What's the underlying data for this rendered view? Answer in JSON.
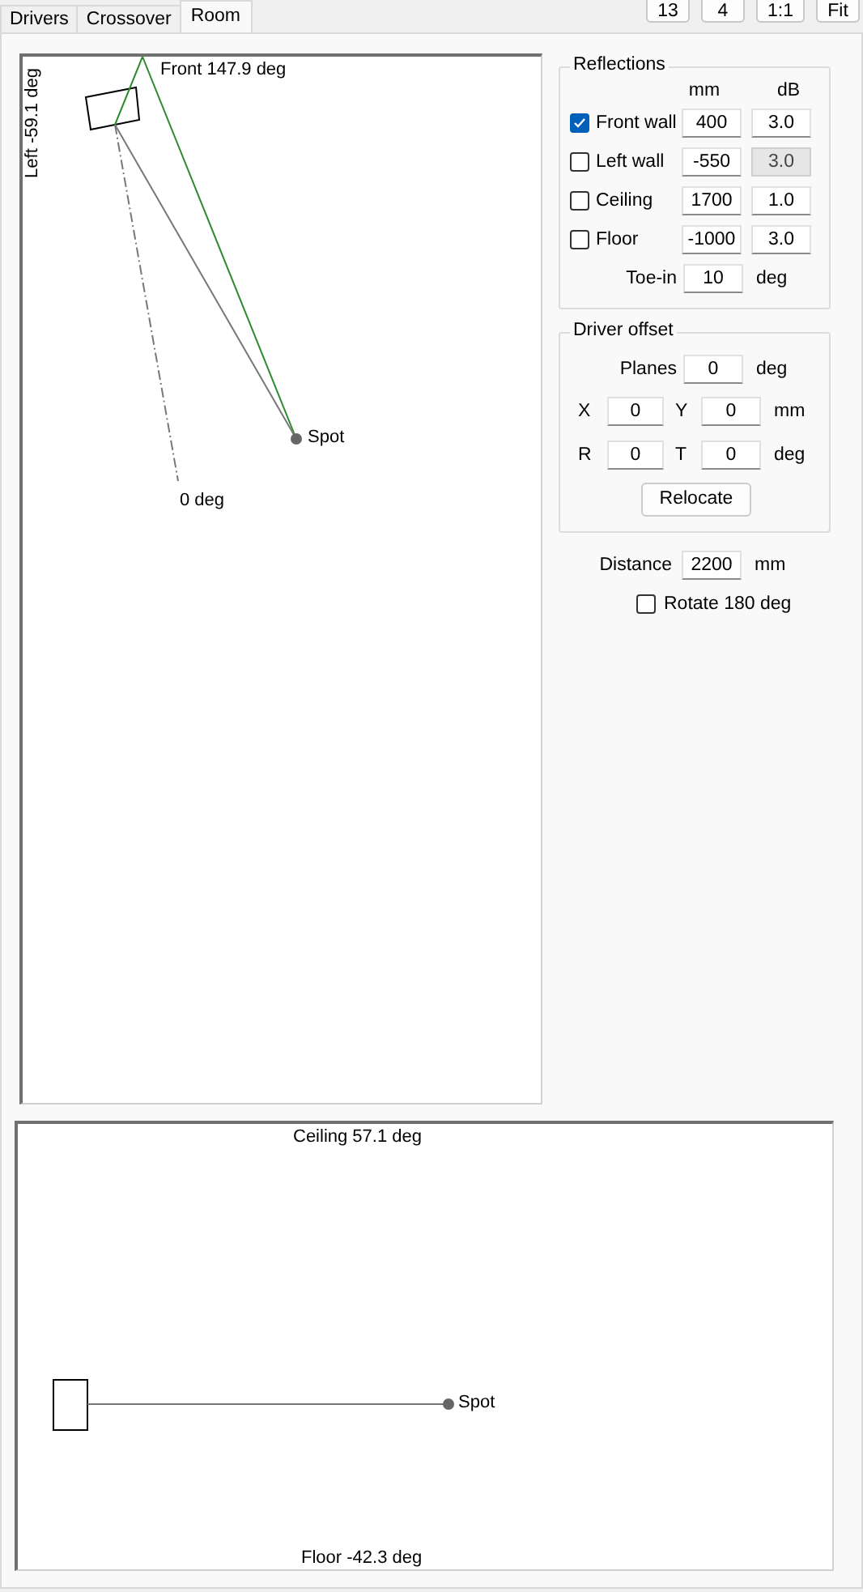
{
  "tabs": [
    {
      "label": "Drivers",
      "selected": false
    },
    {
      "label": "Crossover",
      "selected": false
    },
    {
      "label": "Room",
      "selected": true
    }
  ],
  "toolbar_buttons": [
    "13",
    "4",
    "1:1",
    "Fit"
  ],
  "plan_view": {
    "front_label": "Front 147.9 deg",
    "left_label": "Left -59.1 deg",
    "spot_label": "Spot",
    "axis_label": "0 deg"
  },
  "side_view": {
    "ceiling_label": "Ceiling 57.1 deg",
    "floor_label": "Floor -42.3 deg",
    "spot_label": "Spot"
  },
  "reflections": {
    "title": "Reflections",
    "columns": [
      "mm",
      "dB"
    ],
    "rows": [
      {
        "label": "Front wall",
        "checked": true,
        "mm": "400",
        "db": "3.0",
        "db_disabled": false
      },
      {
        "label": "Left wall",
        "checked": false,
        "mm": "-550",
        "db": "3.0",
        "db_disabled": true
      },
      {
        "label": "Ceiling",
        "checked": false,
        "mm": "1700",
        "db": "1.0",
        "db_disabled": false
      },
      {
        "label": "Floor",
        "checked": false,
        "mm": "-1000",
        "db": "3.0",
        "db_disabled": false
      }
    ],
    "toe_in": {
      "label": "Toe-in",
      "value": "10",
      "unit": "deg"
    }
  },
  "driver_offset": {
    "title": "Driver offset",
    "planes": {
      "label": "Planes",
      "value": "0",
      "unit": "deg"
    },
    "x": {
      "label": "X",
      "value": "0"
    },
    "y": {
      "label": "Y",
      "value": "0"
    },
    "xy_unit": "mm",
    "r": {
      "label": "R",
      "value": "0"
    },
    "t": {
      "label": "T",
      "value": "0"
    },
    "rt_unit": "deg",
    "relocate_button": "Relocate"
  },
  "distance": {
    "label": "Distance",
    "value": "2200",
    "unit": "mm"
  },
  "rotate": {
    "label": "Rotate 180 deg",
    "checked": false
  }
}
